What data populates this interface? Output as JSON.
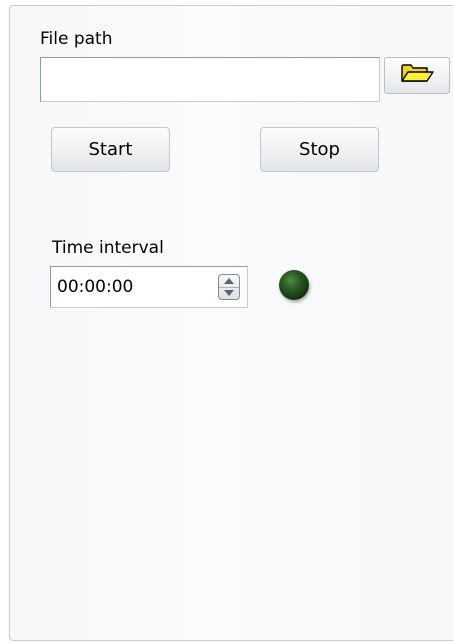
{
  "file_path": {
    "label": "File path",
    "value": "",
    "browse_icon": "folder-open-icon"
  },
  "controls": {
    "start_label": "Start",
    "stop_label": "Stop"
  },
  "time_interval": {
    "label": "Time interval",
    "value": "00:00:00",
    "spinner_icon": "up-down-spinner-icon"
  },
  "indicator": {
    "state": "off",
    "color": "#1f4a1a"
  },
  "colors": {
    "panel_background": "#f7f8fa",
    "panel_border": "#c9ccd0",
    "folder_icon": "#ffe632"
  }
}
